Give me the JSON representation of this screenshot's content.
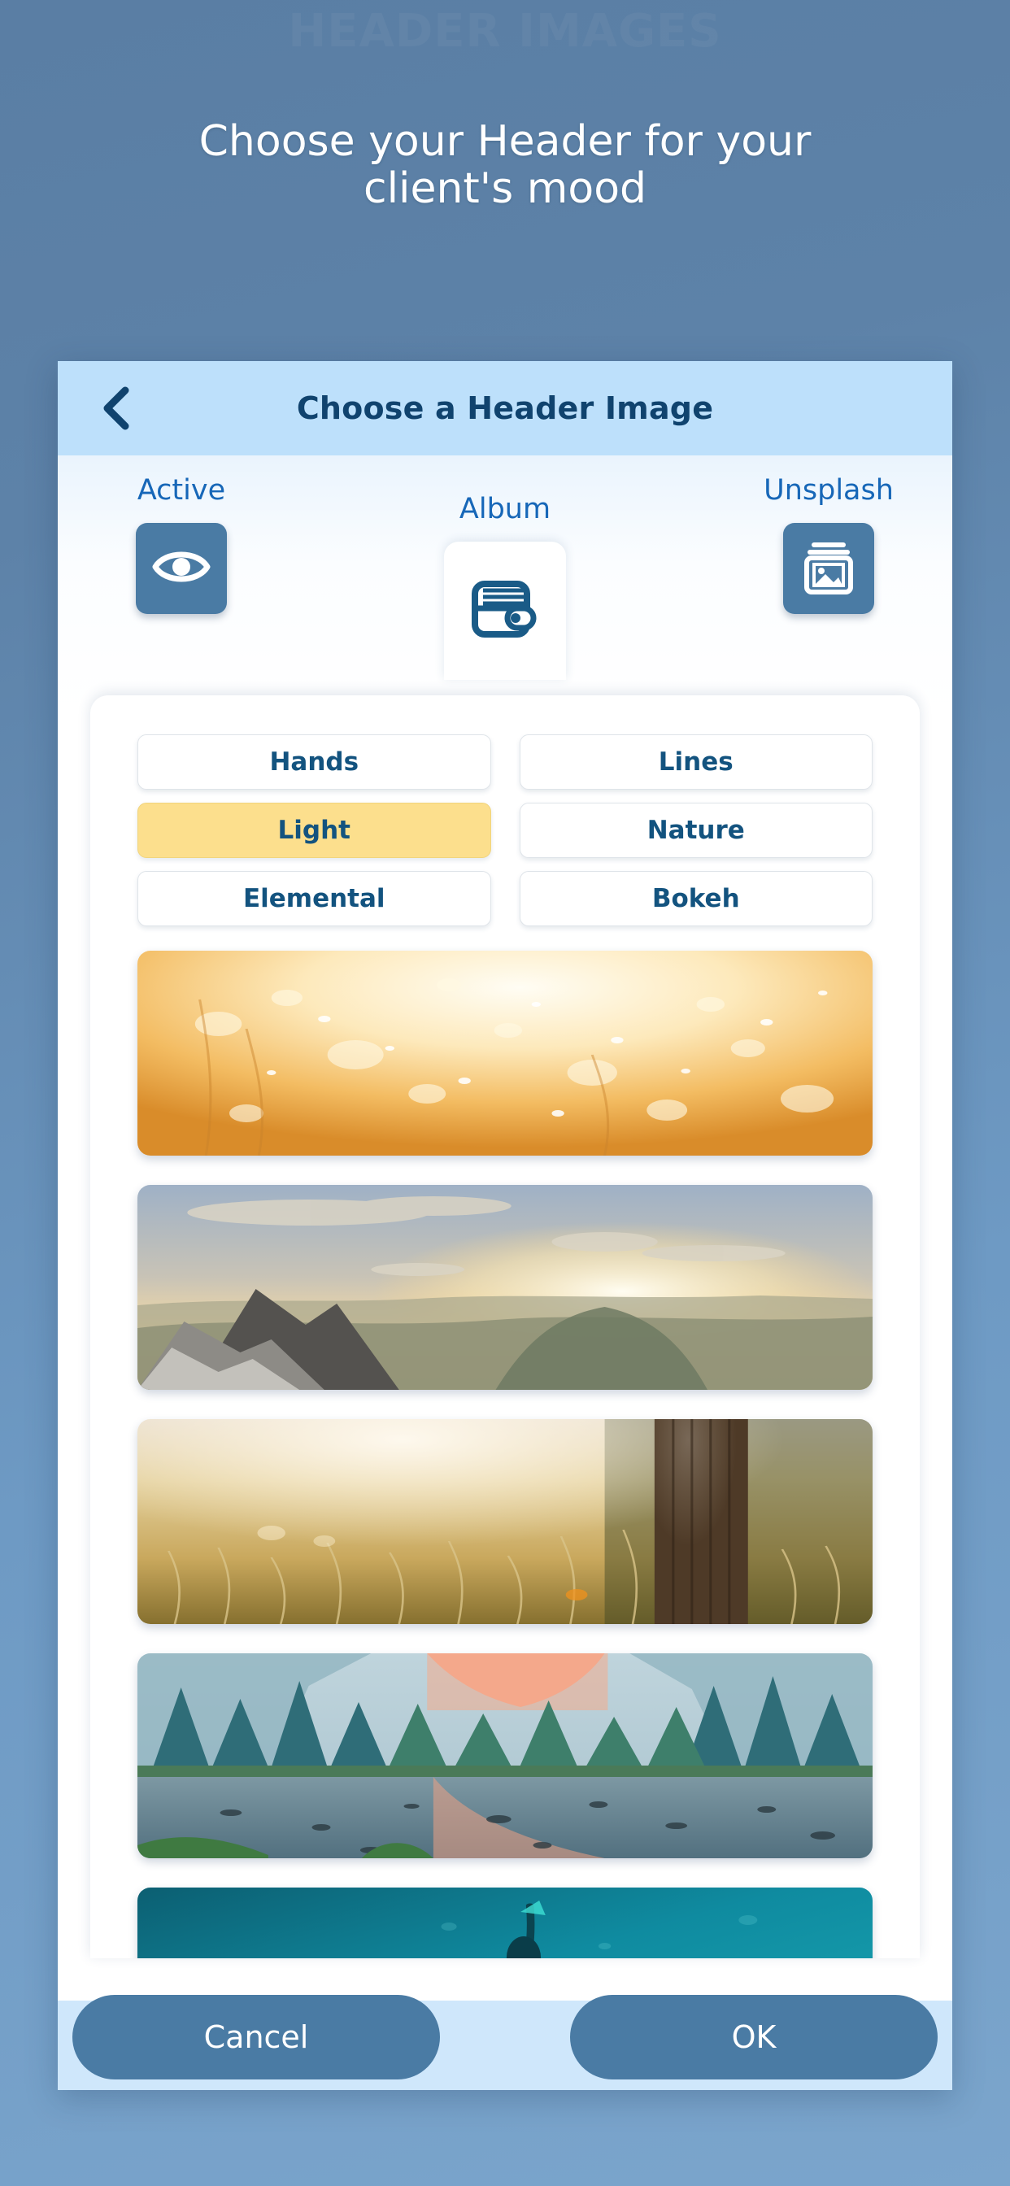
{
  "watermark": "HEADER IMAGES",
  "page": {
    "heading_line1": "Choose your Header for your",
    "heading_line2": "client's mood"
  },
  "dialog": {
    "back_icon": "chevron-left-icon",
    "title": "Choose a Header Image",
    "tabs": [
      {
        "label": "Active",
        "icon": "eye-icon",
        "selected": false
      },
      {
        "label": "Album",
        "icon": "wallet-icon",
        "selected": true
      },
      {
        "label": "Unsplash",
        "icon": "photo-stack-icon",
        "selected": false
      }
    ],
    "categories": [
      {
        "label": "Hands",
        "selected": false
      },
      {
        "label": "Lines",
        "selected": false
      },
      {
        "label": "Light",
        "selected": true
      },
      {
        "label": "Nature",
        "selected": false
      },
      {
        "label": "Elemental",
        "selected": false
      },
      {
        "label": "Bokeh",
        "selected": false
      }
    ],
    "thumbnails": [
      {
        "name": "golden-bokeh-sparkles"
      },
      {
        "name": "mountain-sunset-clouds"
      },
      {
        "name": "sunlit-grass-fence-post"
      },
      {
        "name": "teal-forest-river-dusk"
      },
      {
        "name": "underwater-ocean-diver"
      }
    ],
    "footer": {
      "cancel_label": "Cancel",
      "ok_label": "OK"
    }
  },
  "colors": {
    "background_top": "#5a7ea4",
    "background_bottom": "#7ba5cc",
    "titlebar": "#bde0fb",
    "accent_blue": "#1767b8",
    "icon_tile": "#4a7ba4",
    "chip_text": "#13537f",
    "chip_selected": "#fcdf8d",
    "footer_bar": "#cfe7fb",
    "button": "#4a7ba4"
  }
}
